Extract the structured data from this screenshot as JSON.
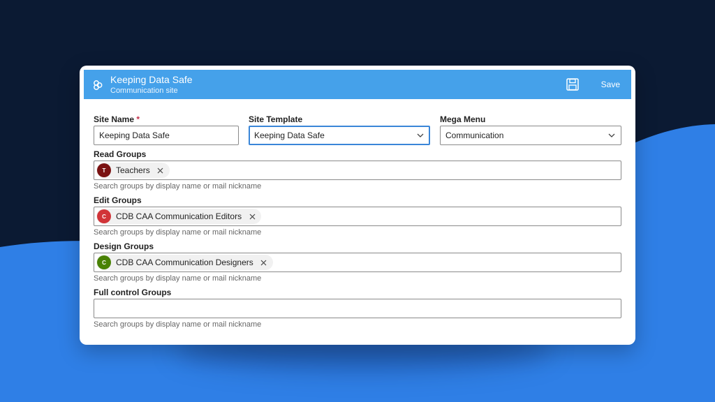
{
  "colors": {
    "header_bg": "#45a1ea",
    "page_bg": "#0b1a33",
    "wave": "#2f7fe6",
    "focus_border": "#3a86d8"
  },
  "header": {
    "title": "Keeping Data Safe",
    "subtitle": "Communication site",
    "site_icon": "sharepoint-icon",
    "save_icon": "floppy-disk-icon",
    "save_label": "Save"
  },
  "form": {
    "site_name": {
      "label": "Site Name",
      "required_mark": "*",
      "value": "Keeping Data Safe"
    },
    "site_template": {
      "label": "Site Template",
      "value": "Keeping Data Safe"
    },
    "mega_menu": {
      "label": "Mega Menu",
      "value": "Communication"
    },
    "read_groups": {
      "label": "Read Groups",
      "chips": [
        {
          "initial": "T",
          "name": "Teachers",
          "color": "#7a1212"
        }
      ],
      "hint": "Search groups by display name or mail nickname"
    },
    "edit_groups": {
      "label": "Edit Groups",
      "chips": [
        {
          "initial": "C",
          "name": "CDB CAA Communication Editors",
          "color": "#d13438"
        }
      ],
      "hint": "Search groups by display name or mail nickname"
    },
    "design_groups": {
      "label": "Design Groups",
      "chips": [
        {
          "initial": "C",
          "name": "CDB CAA Communication Designers",
          "color": "#498205"
        }
      ],
      "hint": "Search groups by display name or mail nickname"
    },
    "full_control_groups": {
      "label": "Full control Groups",
      "hint": "Search groups by display name or mail nickname"
    }
  }
}
